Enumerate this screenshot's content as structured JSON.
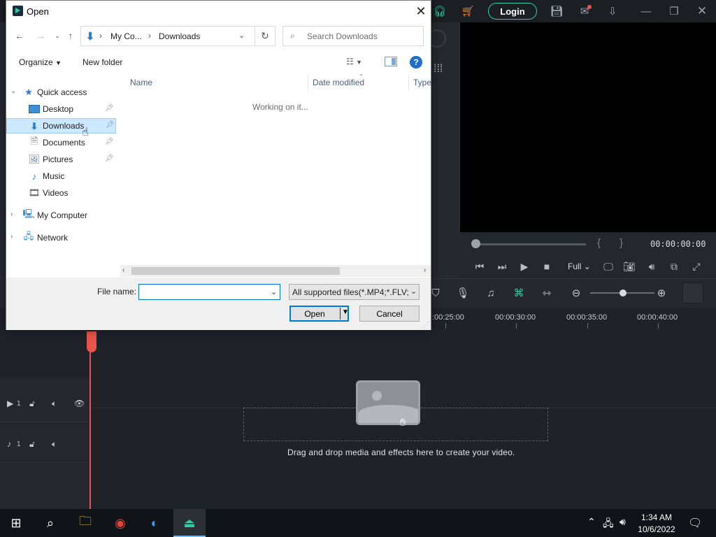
{
  "app": {
    "login_label": "Login",
    "timecode": "00:00:00:00",
    "bracket_in": "{",
    "bracket_out": "}",
    "zoom_mode": "Full",
    "timeline_marks": [
      ":00:25:00",
      "00:00:30:00",
      "00:00:35:00",
      "00:00:40:00"
    ],
    "video_track_label": "1",
    "audio_track_label": "1",
    "drop_hint": "Drag and drop media and effects here to create your video.",
    "accent_color": "#2ad1a7",
    "playhead_color": "#e8534a"
  },
  "dialog": {
    "title": "Open",
    "address": {
      "segments": [
        "My Co...",
        "Downloads"
      ]
    },
    "search_placeholder": "Search Downloads",
    "organize_label": "Organize",
    "new_folder_label": "New folder",
    "help_label": "?",
    "nav": {
      "quick_access": "Quick access",
      "items": [
        {
          "label": "Desktop",
          "icon": "desktop-icon",
          "pinned": true
        },
        {
          "label": "Downloads",
          "icon": "download-arrow-icon",
          "pinned": true,
          "selected": true
        },
        {
          "label": "Documents",
          "icon": "document-icon",
          "pinned": true
        },
        {
          "label": "Pictures",
          "icon": "pictures-icon",
          "pinned": true
        },
        {
          "label": "Music",
          "icon": "music-note-icon",
          "pinned": false
        },
        {
          "label": "Videos",
          "icon": "video-icon",
          "pinned": false
        }
      ],
      "my_computer": "My Computer",
      "network": "Network"
    },
    "columns": [
      "Name",
      "Date modified",
      "Type"
    ],
    "status": "Working on it...",
    "file_name_label": "File name:",
    "file_name_value": "",
    "filter_value": "All supported files(*.MP4;*.FLV;",
    "open_label": "Open",
    "cancel_label": "Cancel"
  },
  "taskbar": {
    "time": "1:34 AM",
    "date": "10/6/2022"
  }
}
